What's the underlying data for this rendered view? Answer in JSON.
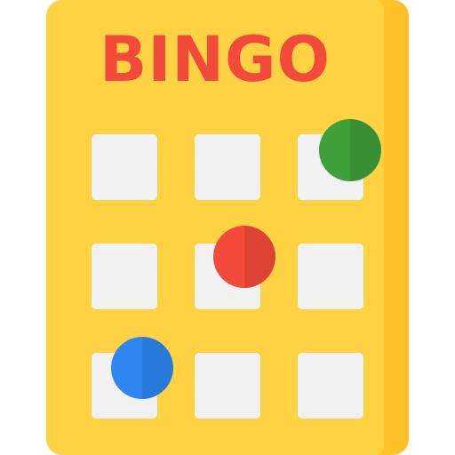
{
  "card": {
    "title": "BINGO"
  },
  "colors": {
    "card_face": "#FFD244",
    "card_edge": "#FFC12A",
    "title": "#F24A3B",
    "cell": "#F1F1F1",
    "ball_green": "#3F9F3A",
    "ball_red": "#F24A3B",
    "ball_blue": "#2E86F0"
  },
  "grid": {
    "rows": 3,
    "columns": 3,
    "marked_cells": [
      {
        "row": 1,
        "column": 3,
        "ball_color": "green"
      },
      {
        "row": 2,
        "column": 2,
        "ball_color": "red"
      },
      {
        "row": 3,
        "column": 1,
        "ball_color": "blue"
      }
    ]
  },
  "icon": "bingo-card-icon"
}
